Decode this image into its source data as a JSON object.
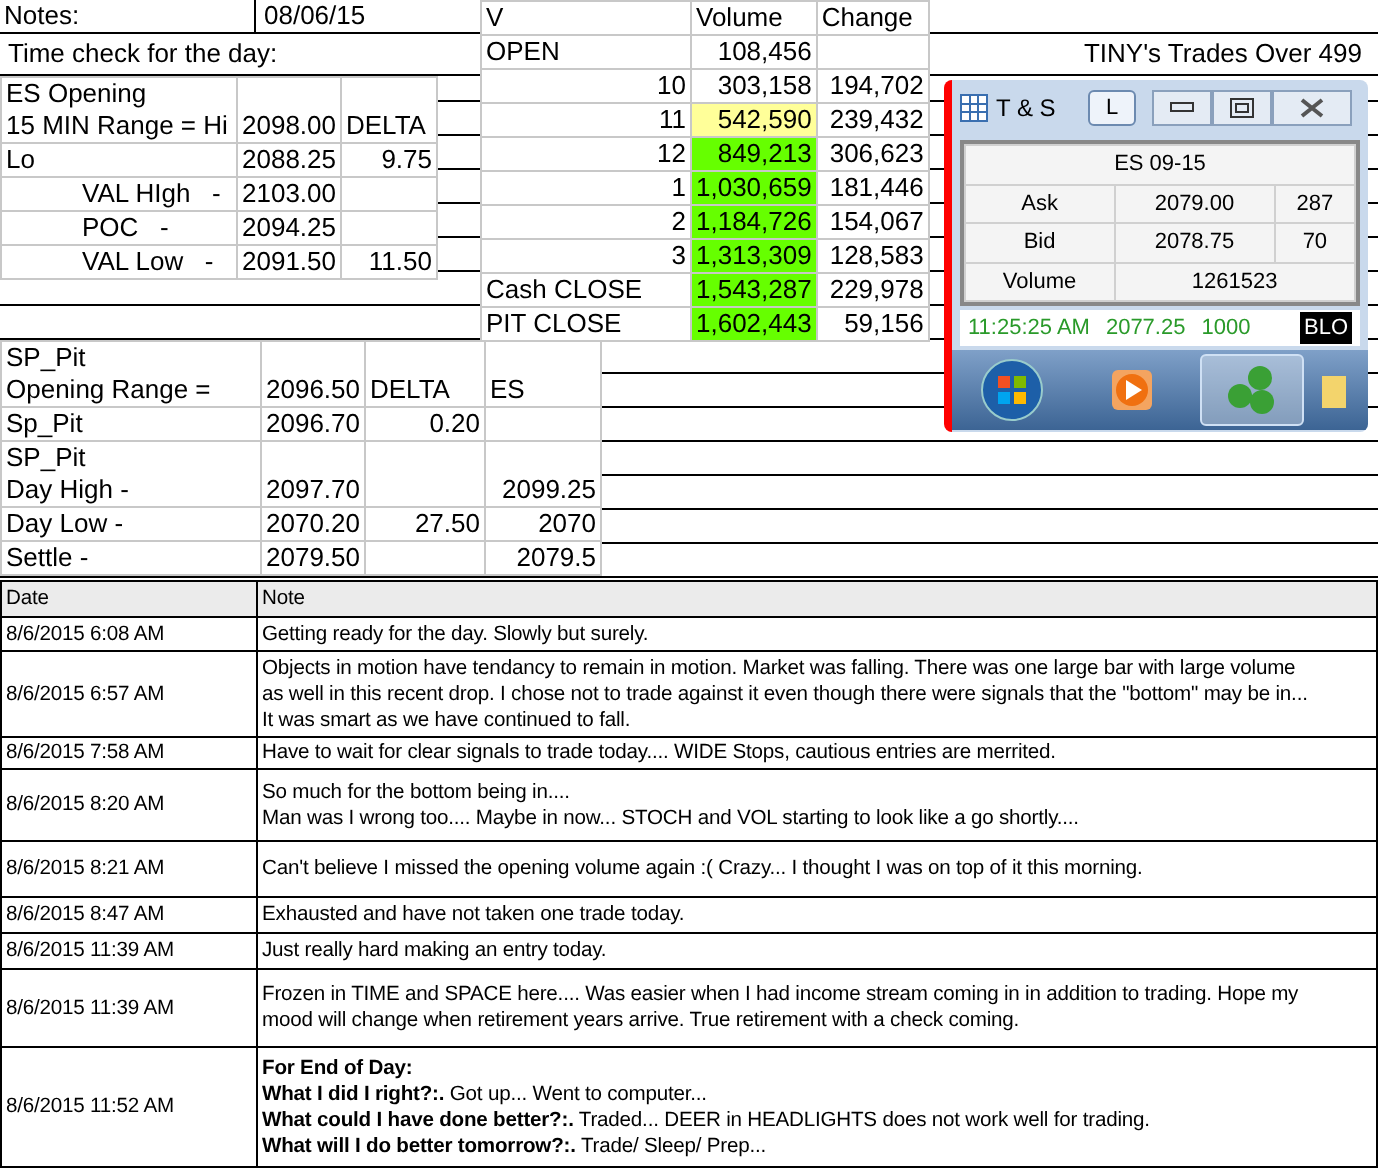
{
  "sheet": {
    "notes_label": "Notes:",
    "date": "08/06/15",
    "time_check": "Time check for the day:",
    "title": "TINY's Trades Over 499"
  },
  "es_opening": {
    "rows": [
      {
        "cells": [
          {
            "text": "ES Opening\n15 MIN Range = Hi",
            "kind": "label"
          },
          {
            "text": "2098.00",
            "kind": "number"
          },
          {
            "text": "DELTA",
            "kind": "label"
          }
        ]
      },
      {
        "cells": [
          {
            "text": "Lo",
            "kind": "label"
          },
          {
            "text": "2088.25",
            "kind": "number"
          },
          {
            "text": "9.75",
            "kind": "number"
          }
        ]
      },
      {
        "cells": [
          {
            "text": "VAL HIgh   -",
            "kind": "indented"
          },
          {
            "text": "2103.00",
            "kind": "number"
          },
          {
            "kind": "empty"
          }
        ]
      },
      {
        "cells": [
          {
            "text": "POC   -",
            "kind": "indented"
          },
          {
            "text": "2094.25",
            "kind": "number"
          },
          {
            "kind": "empty"
          }
        ]
      },
      {
        "cells": [
          {
            "text": "VAL Low   -",
            "kind": "indented"
          },
          {
            "text": "2091.50",
            "kind": "number"
          },
          {
            "text": "11.50",
            "kind": "number"
          }
        ]
      }
    ]
  },
  "volume": {
    "rows": [
      {
        "cells": [
          {
            "text": "V",
            "kind": "label"
          },
          {
            "text": "Volume",
            "kind": "label"
          },
          {
            "text": "Change",
            "kind": "label"
          }
        ]
      },
      {
        "cells": [
          {
            "text": "OPEN",
            "kind": "label"
          },
          {
            "text": "108,456",
            "kind": "number"
          },
          {
            "kind": "empty"
          }
        ]
      },
      {
        "cells": [
          {
            "text": "10",
            "kind": "number"
          },
          {
            "text": "303,158",
            "kind": "number"
          },
          {
            "text": "194,702",
            "kind": "number"
          }
        ]
      },
      {
        "cells": [
          {
            "text": "11",
            "kind": "number"
          },
          {
            "text": "542,590",
            "kind": "number",
            "color": "#ffff99"
          },
          {
            "text": "239,432",
            "kind": "number"
          }
        ]
      },
      {
        "cells": [
          {
            "text": "12",
            "kind": "number"
          },
          {
            "text": "849,213",
            "kind": "number",
            "color": "#66ff00"
          },
          {
            "text": "306,623",
            "kind": "number"
          }
        ]
      },
      {
        "cells": [
          {
            "text": "1",
            "kind": "number"
          },
          {
            "text": "1,030,659",
            "kind": "number",
            "color": "#66ff00"
          },
          {
            "text": "181,446",
            "kind": "number"
          }
        ]
      },
      {
        "cells": [
          {
            "text": "2",
            "kind": "number"
          },
          {
            "text": "1,184,726",
            "kind": "number",
            "color": "#66ff00"
          },
          {
            "text": "154,067",
            "kind": "number"
          }
        ]
      },
      {
        "cells": [
          {
            "text": "3",
            "kind": "number"
          },
          {
            "text": "1,313,309",
            "kind": "number",
            "color": "#66ff00"
          },
          {
            "text": "128,583",
            "kind": "number"
          }
        ]
      },
      {
        "cells": [
          {
            "text": "Cash CLOSE",
            "kind": "label"
          },
          {
            "text": "1,543,287",
            "kind": "number",
            "color": "#66ff00"
          },
          {
            "text": "229,978",
            "kind": "number"
          }
        ]
      },
      {
        "cells": [
          {
            "text": "PIT CLOSE",
            "kind": "label"
          },
          {
            "text": "1,602,443",
            "kind": "number",
            "color": "#66ff00"
          },
          {
            "text": "59,156",
            "kind": "number"
          }
        ]
      }
    ]
  },
  "sp_pit": {
    "rows": [
      {
        "cells": [
          {
            "text": "SP_Pit\nOpening Range =",
            "kind": "label"
          },
          {
            "text": "2096.50",
            "kind": "number"
          },
          {
            "text": "DELTA",
            "kind": "label"
          },
          {
            "text": "ES",
            "kind": "label"
          }
        ]
      },
      {
        "cells": [
          {
            "text": "Sp_Pit",
            "kind": "label"
          },
          {
            "text": "2096.70",
            "kind": "number"
          },
          {
            "text": "0.20",
            "kind": "number"
          },
          {
            "kind": "empty"
          }
        ]
      },
      {
        "cells": [
          {
            "text": "SP_Pit\nDay High -",
            "kind": "label"
          },
          {
            "text": "2097.70",
            "kind": "number"
          },
          {
            "kind": "empty"
          },
          {
            "text": "2099.25",
            "kind": "number"
          }
        ]
      },
      {
        "cells": [
          {
            "text": "Day Low -",
            "kind": "label"
          },
          {
            "text": "2070.20",
            "kind": "number"
          },
          {
            "text": "27.50",
            "kind": "number"
          },
          {
            "text": "2070",
            "kind": "number"
          }
        ]
      },
      {
        "cells": [
          {
            "text": "Settle -",
            "kind": "label"
          },
          {
            "text": "2079.50",
            "kind": "number"
          },
          {
            "kind": "empty"
          },
          {
            "text": "2079.5",
            "kind": "number"
          }
        ]
      }
    ]
  },
  "ts_window": {
    "title": "T & S",
    "buttons": [
      "L"
    ],
    "symbol": "ES 09-15",
    "quotes": [
      {
        "label": "Ask",
        "price": "2079.00",
        "size": "287"
      },
      {
        "label": "Bid",
        "price": "2078.75",
        "size": "70"
      }
    ],
    "volume": {
      "label": "Volume",
      "value": "1261523"
    },
    "ticker": {
      "time": "11:25:25 AM",
      "price": "2077.25",
      "size": "1000",
      "tag": "BLO"
    },
    "taskbar": [
      {
        "kind": "start",
        "selected": false
      },
      {
        "kind": "media",
        "selected": false
      },
      {
        "kind": "money",
        "selected": true
      },
      {
        "kind": "folder",
        "selected": false
      }
    ]
  },
  "notes": {
    "columns": [
      "Date",
      "Note"
    ],
    "rows": [
      {
        "date": "8/6/2015 6:08 AM",
        "note": "Getting ready for the day.  Slowly but surely."
      },
      {
        "date": "8/6/2015 6:57 AM",
        "note": "Objects in motion have tendancy to remain in motion.  Market was falling.  There was one large bar with large volume\nas well in this recent drop.  I chose not to trade against it even though there were signals that the \"bottom\" may be in...\nIt was smart as we have continued to fall."
      },
      {
        "date": "8/6/2015 7:58 AM",
        "note": "Have to wait for clear signals to trade today.... WIDE Stops, cautious entries are merrited."
      },
      {
        "date": "8/6/2015 8:20 AM",
        "note": "So much for the bottom being in....\nMan was I wrong too.... Maybe in now... STOCH and VOL starting to look like a go shortly...."
      },
      {
        "date": "8/6/2015 8:21 AM",
        "note": "Can't believe I missed the opening volume again :(    Crazy... I thought I was on top of it this morning."
      },
      {
        "date": "8/6/2015 8:47 AM",
        "note": "Exhausted and have not taken one trade today."
      },
      {
        "date": "8/6/2015 11:39 AM",
        "note": "Just really hard making an entry today."
      },
      {
        "date": "8/6/2015 11:39 AM",
        "note": "Frozen in TIME and SPACE here.... Was easier when I had income stream coming in in addition to trading.  Hope my\nmood will change when retirement years arrive.  True retirement with a check coming."
      },
      {
        "date": "8/6/2015 11:52 AM",
        "note": "**For End of Day:**\n**What I did I right?:.**  Got up... Went to computer...\n**What could I have done better?:.**  Traded... DEER in HEADLIGHTS does not work well for trading.\n**What will I do better tomorrow?:.**  Trade/ Sleep/ Prep..."
      }
    ]
  }
}
